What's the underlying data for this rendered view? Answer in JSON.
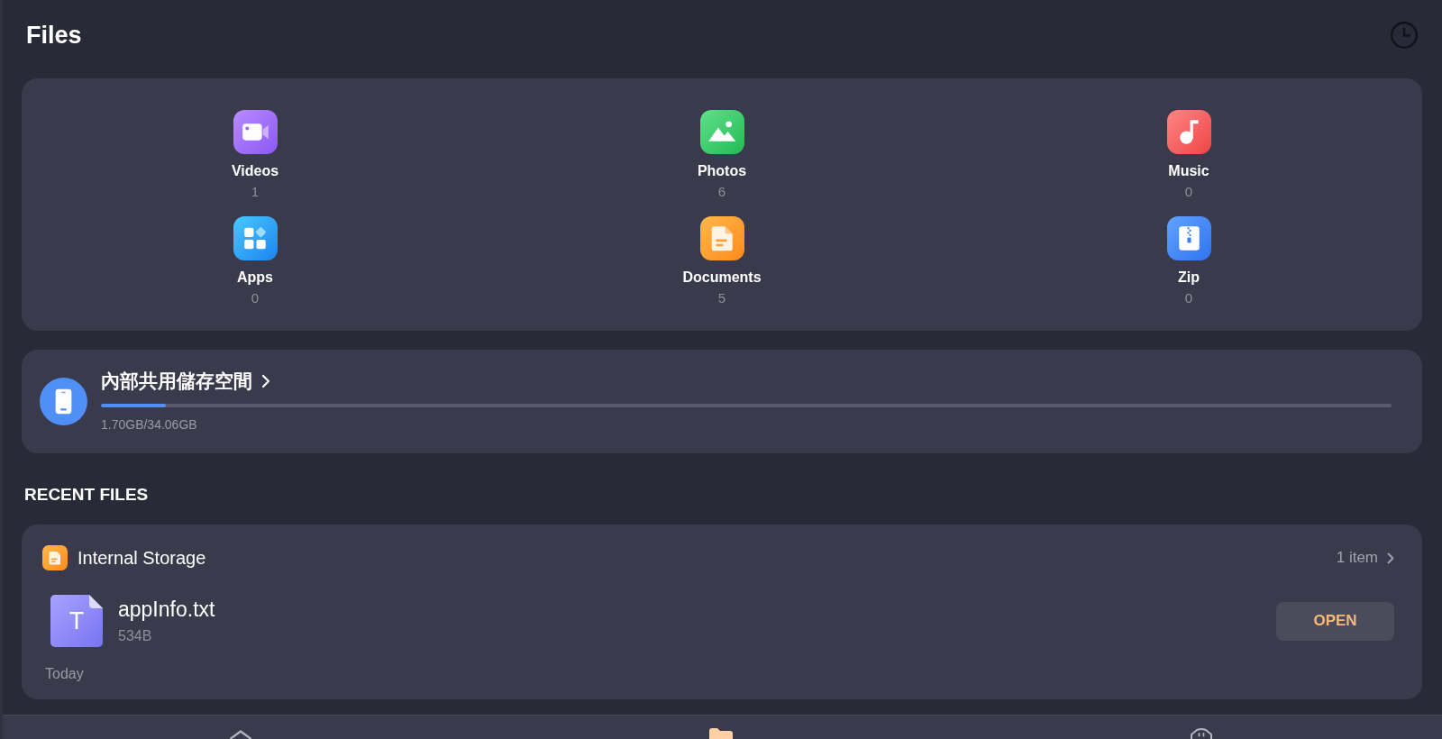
{
  "header": {
    "title": "Files"
  },
  "categories": [
    {
      "kind": "video",
      "label": "Videos",
      "count": "1"
    },
    {
      "kind": "photo",
      "label": "Photos",
      "count": "6"
    },
    {
      "kind": "music",
      "label": "Music",
      "count": "0"
    },
    {
      "kind": "app",
      "label": "Apps",
      "count": "0"
    },
    {
      "kind": "document",
      "label": "Documents",
      "count": "5"
    },
    {
      "kind": "zip",
      "label": "Zip",
      "count": "0"
    }
  ],
  "storage": {
    "title": "內部共用儲存空間",
    "level": 0.05,
    "usage": "1.70GB/34.06GB"
  },
  "recent_files": {
    "heading": "RECENT FILES",
    "groups": [
      {
        "source": "Internal Storage",
        "item_count": "1 item",
        "files": [
          {
            "name": "appInfo.txt",
            "size": "534B",
            "type_letter": "T",
            "action": "OPEN"
          }
        ],
        "date": "Today"
      }
    ]
  },
  "bottom_nav": [
    {
      "kind": "home",
      "selected": false
    },
    {
      "kind": "folder",
      "selected": true
    },
    {
      "kind": "robot",
      "selected": false
    }
  ]
}
